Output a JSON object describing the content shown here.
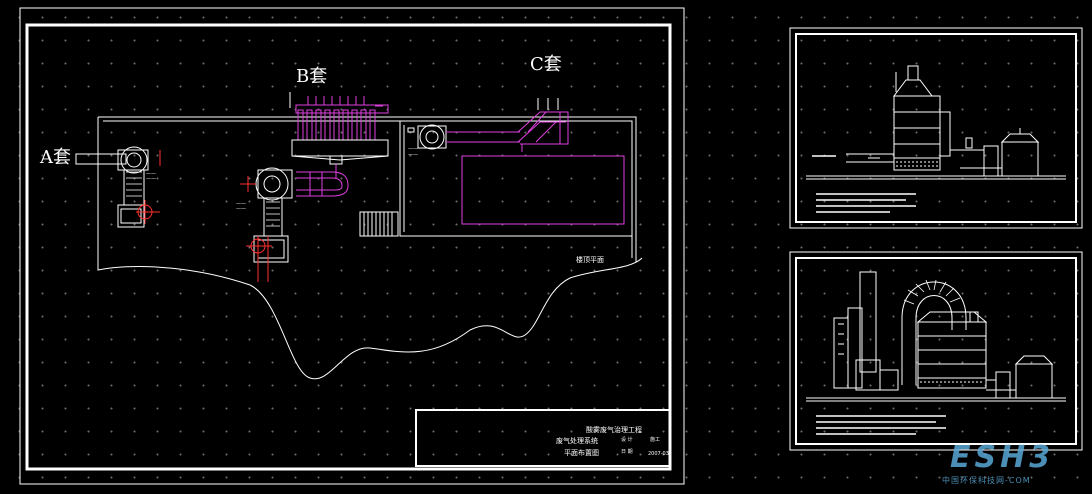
{
  "labels": {
    "set_a": "A套",
    "set_b": "B套",
    "set_c": "C套",
    "roof_plan": "楼顶平面"
  },
  "title_block": {
    "project": "酸雾废气治理工程",
    "system": "废气处理系统",
    "drawing": "平面布置图",
    "field_1": "设 计",
    "field_2": "施工",
    "field_3": "日 期",
    "date": "2007-03"
  },
  "watermark": {
    "logo": "ESH3",
    "site": "中国环保科技网-COM"
  },
  "colors": {
    "background": "#000000",
    "frame": "#ffffff",
    "duct": "#e040e0",
    "equipment": "#ffffff",
    "marker": "#ff3030",
    "watermark": "#5aa9d6"
  }
}
